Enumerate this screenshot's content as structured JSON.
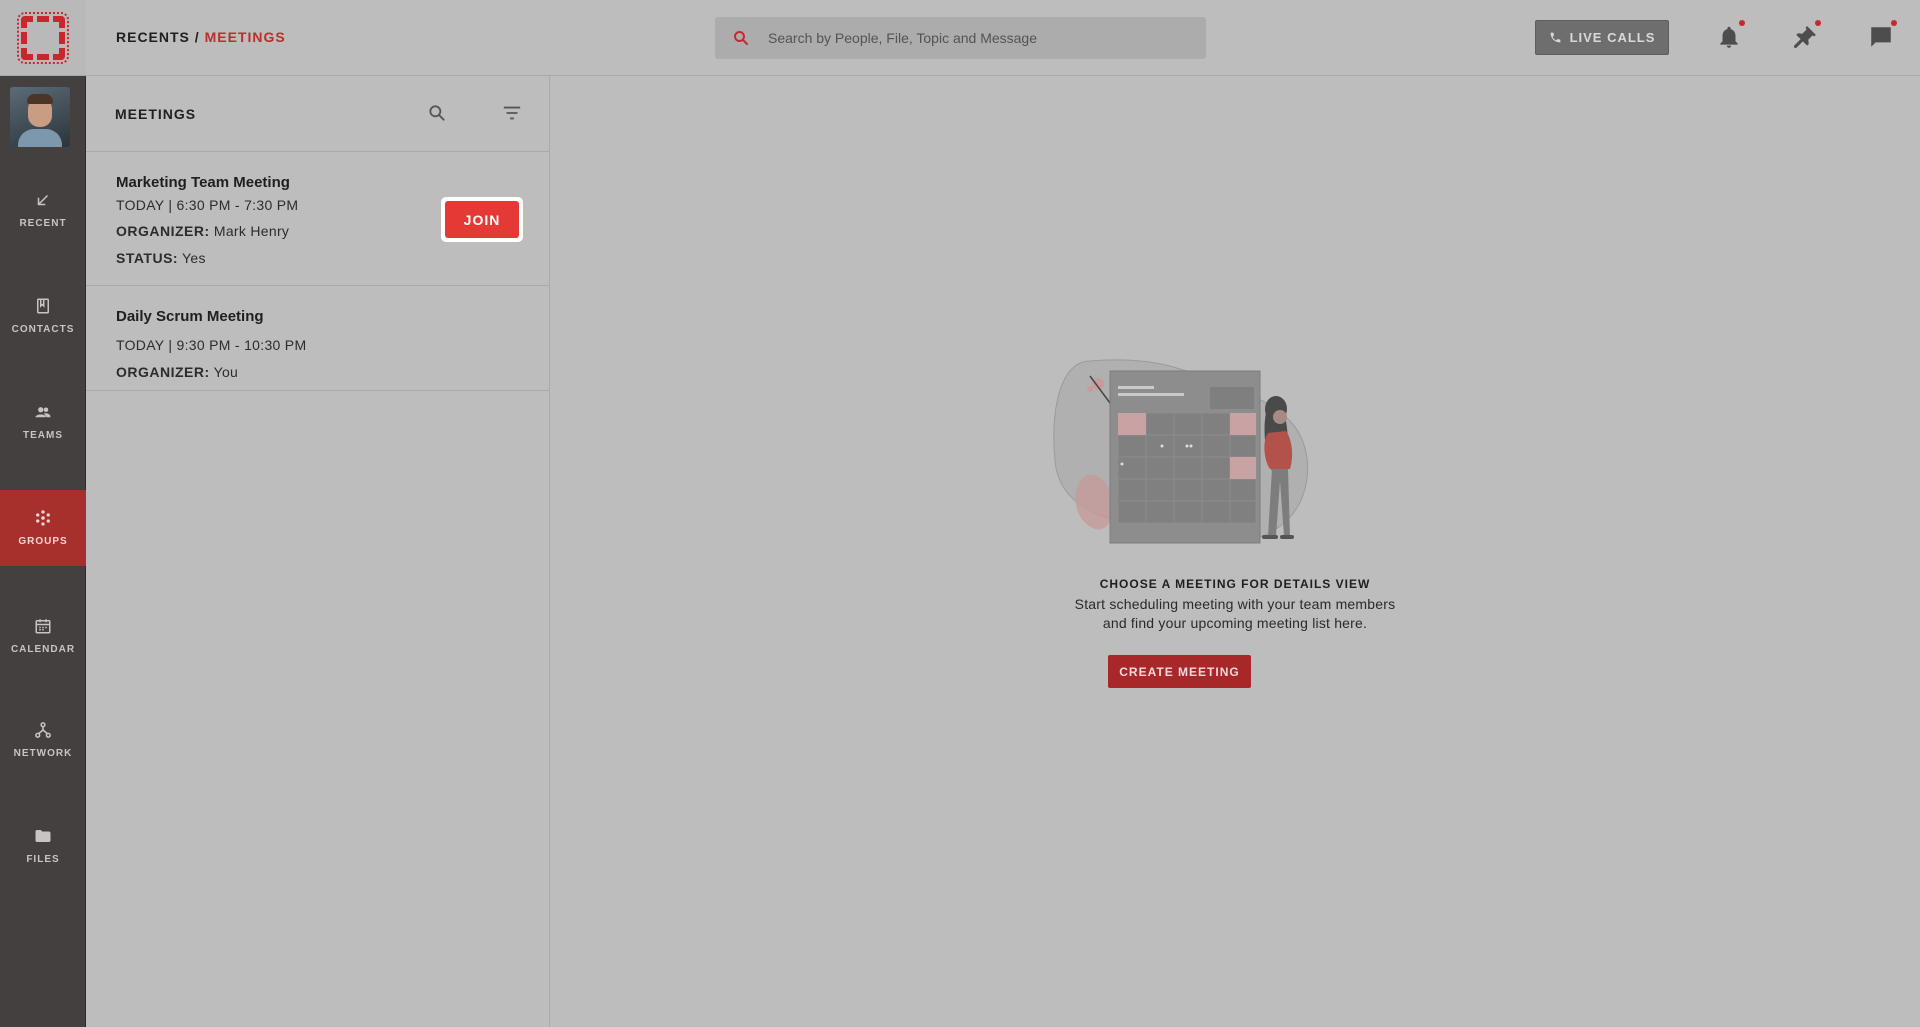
{
  "colors": {
    "accent": "#b8302c",
    "join": "#e53935",
    "rail": "#454040",
    "rail_active": "#a8302c",
    "overlay": "#bdbdbd"
  },
  "breadcrumb": {
    "root": "RECENTS",
    "separator": " / ",
    "current": "MEETINGS"
  },
  "search": {
    "placeholder": "Search by People, File, Topic and Message",
    "icon": "search-icon"
  },
  "header": {
    "live_calls_label": "LIVE CALLS",
    "icons": [
      "notifications-bell-icon",
      "pin-icon",
      "chat-icon"
    ]
  },
  "nav": {
    "items": [
      {
        "label": "RECENT",
        "icon": "arrow-down-left-icon",
        "active": false
      },
      {
        "label": "CONTACTS",
        "icon": "contact-book-icon",
        "active": false
      },
      {
        "label": "TEAMS",
        "icon": "team-icon",
        "active": false
      },
      {
        "label": "GROUPS",
        "icon": "groups-icon",
        "active": true
      },
      {
        "label": "CALENDAR",
        "icon": "calendar-icon",
        "active": false
      },
      {
        "label": "NETWORK",
        "icon": "network-icon",
        "active": false
      },
      {
        "label": "FILES",
        "icon": "folder-icon",
        "active": false
      }
    ]
  },
  "panel": {
    "title": "MEETINGS",
    "meetings": [
      {
        "title": "Marketing Team Meeting",
        "time": "TODAY | 6:30 PM - 7:30 PM",
        "organizer_label": "ORGANIZER:",
        "organizer": "Mark Henry",
        "status_label": "STATUS:",
        "status": "Yes",
        "join_label": "JOIN"
      },
      {
        "title": "Daily Scrum Meeting",
        "time": "TODAY | 9:30 PM - 10:30 PM",
        "organizer_label": "ORGANIZER:",
        "organizer": "You"
      }
    ]
  },
  "empty_state": {
    "title": "CHOOSE A MEETING FOR DETAILS VIEW",
    "line1": "Start scheduling meeting with your team members",
    "line2": "and find your upcoming meeting list here.",
    "button": "CREATE MEETING"
  }
}
